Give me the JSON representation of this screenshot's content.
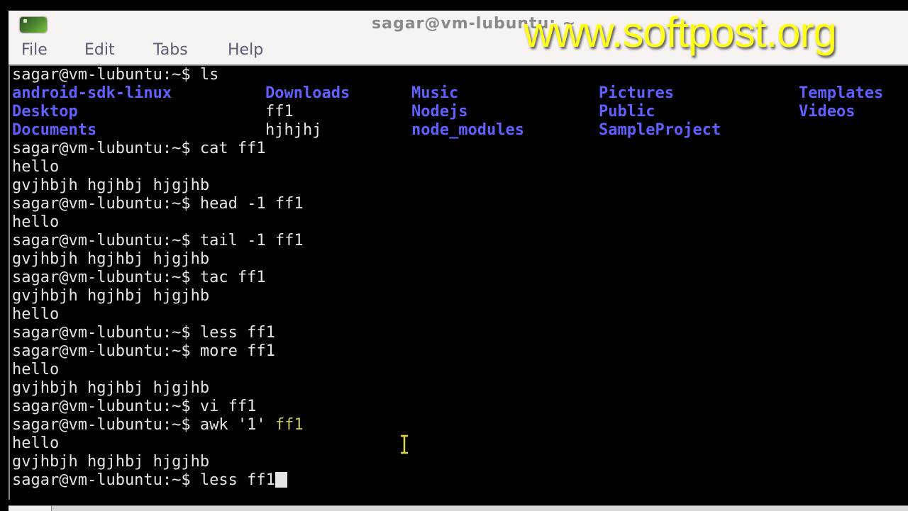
{
  "window": {
    "title": "sagar@vm-lubuntu: ~",
    "icon": "terminal-icon"
  },
  "menu": {
    "items": [
      {
        "label": "File"
      },
      {
        "label": "Edit"
      },
      {
        "label": "Tabs"
      },
      {
        "label": "Help"
      }
    ]
  },
  "watermark": "www.softpost.org",
  "colors": {
    "directory": "#6060ff",
    "text": "#e4e4e4",
    "watermark": "#ffff1a",
    "background": "#000000"
  },
  "terminal": {
    "prompt": "sagar@vm-lubuntu:~$",
    "ls_cmd": " ls",
    "ls_output": [
      [
        "android-sdk-linux",
        "Downloads",
        "Music",
        "Pictures",
        "Templates"
      ],
      [
        "Desktop",
        "ff1",
        "Nodejs",
        "Public",
        "Videos"
      ],
      [
        "Documents",
        "hjhjhj",
        "node_modules",
        "SampleProject",
        ""
      ]
    ],
    "lines": [
      {
        "type": "cmd",
        "text": " cat ff1"
      },
      {
        "type": "out",
        "text": "hello"
      },
      {
        "type": "out",
        "text": "gvjhbjh hgjhbj hjgjhb"
      },
      {
        "type": "cmd",
        "text": " head -1 ff1"
      },
      {
        "type": "out",
        "text": "hello"
      },
      {
        "type": "cmd",
        "text": " tail -1 ff1"
      },
      {
        "type": "out",
        "text": "gvjhbjh hgjhbj hjgjhb"
      },
      {
        "type": "cmd",
        "text": " tac ff1"
      },
      {
        "type": "out",
        "text": "gvjhbjh hgjhbj hjgjhb"
      },
      {
        "type": "out",
        "text": "hello"
      },
      {
        "type": "cmd",
        "text": " less ff1"
      },
      {
        "type": "cmd",
        "text": " more ff1"
      },
      {
        "type": "out",
        "text": "hello"
      },
      {
        "type": "out",
        "text": "gvjhbjh hgjhbj hjgjhb"
      },
      {
        "type": "cmd",
        "text": " vi ff1"
      }
    ],
    "awk_cmd": " awk '1' ",
    "awk_arg": "ff1",
    "awk_output": [
      "hello",
      "gvjhbjh hgjhbj hjgjhb"
    ],
    "current_input": " less ff1"
  }
}
